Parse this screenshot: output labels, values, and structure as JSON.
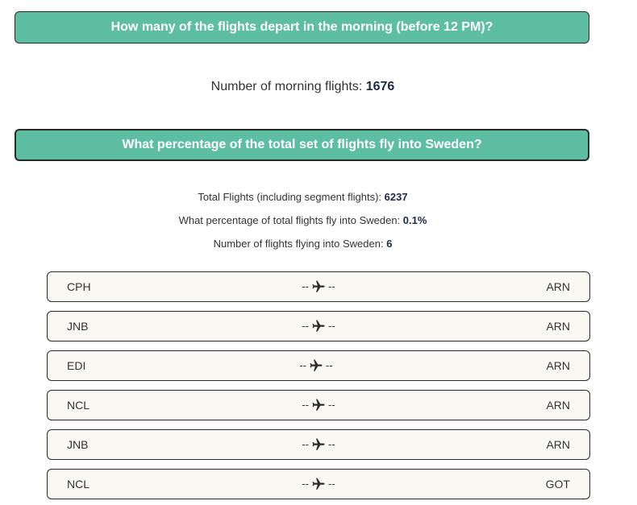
{
  "questions": [
    {
      "text": "How many of the flights depart in the morning (before 12 PM)?",
      "answers": [
        {
          "label": "Number of morning flights: ",
          "value": "1676"
        }
      ]
    },
    {
      "text": "What percentage of the total set of flights fly into Sweden?",
      "answers": [
        {
          "label": "Total Flights (including segment flights): ",
          "value": "6237"
        },
        {
          "label": "What percentage of total flights fly into Sweden: ",
          "value": "0.1%"
        },
        {
          "label": "Number of flights flying into Sweden: ",
          "value": "6"
        }
      ]
    }
  ],
  "route_separator": "--",
  "route_icon": "airplane-icon",
  "flights": [
    {
      "origin": "CPH",
      "destination": "ARN"
    },
    {
      "origin": "JNB",
      "destination": "ARN"
    },
    {
      "origin": "EDI",
      "destination": "ARN"
    },
    {
      "origin": "NCL",
      "destination": "ARN"
    },
    {
      "origin": "JNB",
      "destination": "ARN"
    },
    {
      "origin": "NCL",
      "destination": "GOT"
    }
  ],
  "colors": {
    "question_bar": "#5ebea1",
    "flight_row_bg": "#f9f8f3",
    "value_text": "#1d2a44"
  }
}
